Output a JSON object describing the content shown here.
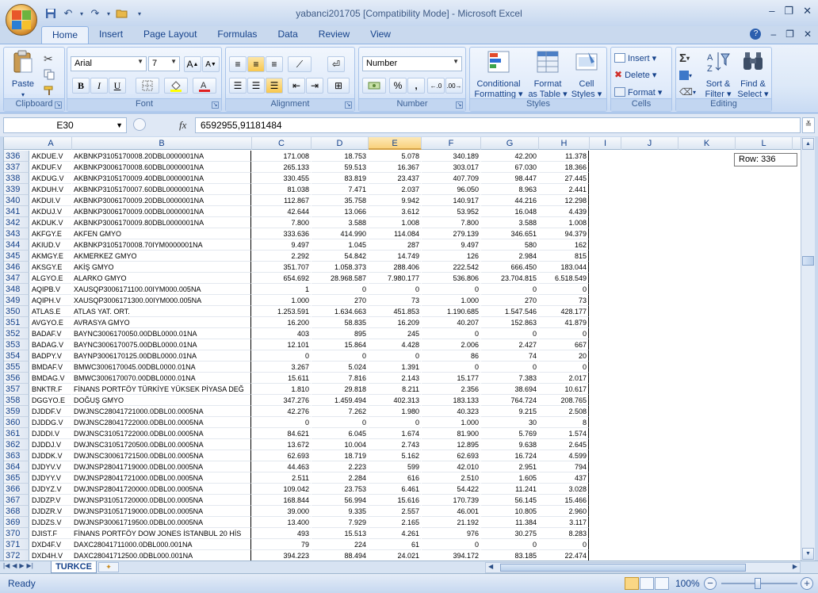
{
  "window": {
    "title": "yabanci201705  [Compatibility Mode] - Microsoft Excel",
    "minimize": "–",
    "restore": "❐",
    "close": "✕"
  },
  "ribbon_tabs": [
    "Home",
    "Insert",
    "Page Layout",
    "Formulas",
    "Data",
    "Review",
    "View"
  ],
  "help_icon": "?",
  "ribbon": {
    "clipboard": {
      "label": "Clipboard",
      "paste": "Paste"
    },
    "font": {
      "label": "Font",
      "font_name": "Arial",
      "font_size": "7"
    },
    "alignment": {
      "label": "Alignment"
    },
    "number": {
      "label": "Number",
      "format": "Number",
      "percent": "%",
      "comma": ",",
      "inc_dec": "⁺⁰.00",
      "dec_dec": ".00→.0"
    },
    "styles": {
      "label": "Styles",
      "conditional": "Conditional",
      "conditional2": "Formatting ▾",
      "format_as": "Format",
      "format_as2": "as Table ▾",
      "cell_styles": "Cell",
      "cell_styles2": "Styles ▾"
    },
    "cells": {
      "label": "Cells",
      "insert": "Insert ▾",
      "delete": "Delete ▾",
      "format": "Format ▾"
    },
    "editing": {
      "label": "Editing",
      "sort": "Sort &",
      "sort2": "Filter ▾",
      "find": "Find &",
      "find2": "Select ▾"
    }
  },
  "formula_bar": {
    "name_box": "E30",
    "fx": "fx",
    "formula": "6592955,91181484"
  },
  "columns": [
    "A",
    "B",
    "C",
    "D",
    "E",
    "F",
    "G",
    "H",
    "I",
    "J",
    "K",
    "L"
  ],
  "selected_column": "E",
  "tooltip": "Row: 336",
  "rows": [
    {
      "n": "336",
      "a": "AKDUE.V",
      "b": "AKBNKP3105170008.20DBL0000001NA",
      "c": "171.008",
      "d": "18.753",
      "e": "5.078",
      "f": "340.189",
      "g": "42.200",
      "h": "11.378"
    },
    {
      "n": "337",
      "a": "AKDUF.V",
      "b": "AKBNKP3006170008.60DBL0000001NA",
      "c": "265.133",
      "d": "59.513",
      "e": "16.367",
      "f": "303.017",
      "g": "67.030",
      "h": "18.366"
    },
    {
      "n": "338",
      "a": "AKDUG.V",
      "b": "AKBNKP3105170009.40DBL0000001NA",
      "c": "330.455",
      "d": "83.819",
      "e": "23.437",
      "f": "407.709",
      "g": "98.447",
      "h": "27.445"
    },
    {
      "n": "339",
      "a": "AKDUH.V",
      "b": "AKBNKP3105170007.60DBL0000001NA",
      "c": "81.038",
      "d": "7.471",
      "e": "2.037",
      "f": "96.050",
      "g": "8.963",
      "h": "2.441"
    },
    {
      "n": "340",
      "a": "AKDUI.V",
      "b": "AKBNKP3006170009.20DBL0000001NA",
      "c": "112.867",
      "d": "35.758",
      "e": "9.942",
      "f": "140.917",
      "g": "44.216",
      "h": "12.298"
    },
    {
      "n": "341",
      "a": "AKDUJ.V",
      "b": "AKBNKP3006170009.00DBL0000001NA",
      "c": "42.644",
      "d": "13.066",
      "e": "3.612",
      "f": "53.952",
      "g": "16.048",
      "h": "4.439"
    },
    {
      "n": "342",
      "a": "AKDUK.V",
      "b": "AKBNKP3006170009.80DBL0000001NA",
      "c": "7.800",
      "d": "3.588",
      "e": "1.008",
      "f": "7.800",
      "g": "3.588",
      "h": "1.008"
    },
    {
      "n": "343",
      "a": "AKFGY.E",
      "b": "AKFEN GMYO",
      "c": "333.636",
      "d": "414.990",
      "e": "114.084",
      "f": "279.139",
      "g": "346.651",
      "h": "94.379"
    },
    {
      "n": "344",
      "a": "AKIUD.V",
      "b": "AKBNKP3105170008.70IYM0000001NA",
      "c": "9.497",
      "d": "1.045",
      "e": "287",
      "f": "9.497",
      "g": "580",
      "h": "162"
    },
    {
      "n": "345",
      "a": "AKMGY.E",
      "b": "AKMERKEZ GMYO",
      "c": "2.292",
      "d": "54.842",
      "e": "14.749",
      "f": "126",
      "g": "2.984",
      "h": "815"
    },
    {
      "n": "346",
      "a": "AKSGY.E",
      "b": "AKİŞ GMYO",
      "c": "351.707",
      "d": "1.058.373",
      "e": "288.406",
      "f": "222.542",
      "g": "666.450",
      "h": "183.044"
    },
    {
      "n": "347",
      "a": "ALGYO.E",
      "b": "ALARKO GMYO",
      "c": "654.692",
      "d": "28.968.587",
      "e": "7.980.177",
      "f": "536.806",
      "g": "23.704.815",
      "h": "6.518.549"
    },
    {
      "n": "348",
      "a": "AQIPB.V",
      "b": "XAUSQP3006171100.00IYM000.005NA",
      "c": "1",
      "d": "0",
      "e": "0",
      "f": "0",
      "g": "0",
      "h": "0"
    },
    {
      "n": "349",
      "a": "AQIPH.V",
      "b": "XAUSQP3006171300.00IYM000.005NA",
      "c": "1.000",
      "d": "270",
      "e": "73",
      "f": "1.000",
      "g": "270",
      "h": "73"
    },
    {
      "n": "350",
      "a": "ATLAS.E",
      "b": "ATLAS YAT. ORT.",
      "c": "1.253.591",
      "d": "1.634.663",
      "e": "451.853",
      "f": "1.190.685",
      "g": "1.547.546",
      "h": "428.177"
    },
    {
      "n": "351",
      "a": "AVGYO.E",
      "b": "AVRASYA GMYO",
      "c": "16.200",
      "d": "58.835",
      "e": "16.209",
      "f": "40.207",
      "g": "152.863",
      "h": "41.879"
    },
    {
      "n": "352",
      "a": "BADAF.V",
      "b": "BAYNC3006170050.00DBL0000.01NA",
      "c": "403",
      "d": "895",
      "e": "245",
      "f": "0",
      "g": "0",
      "h": "0"
    },
    {
      "n": "353",
      "a": "BADAG.V",
      "b": "BAYNC3006170075.00DBL0000.01NA",
      "c": "12.101",
      "d": "15.864",
      "e": "4.428",
      "f": "2.006",
      "g": "2.427",
      "h": "667"
    },
    {
      "n": "354",
      "a": "BADPY.V",
      "b": "BAYNP3006170125.00DBL0000.01NA",
      "c": "0",
      "d": "0",
      "e": "0",
      "f": "86",
      "g": "74",
      "h": "20"
    },
    {
      "n": "355",
      "a": "BMDAF.V",
      "b": "BMWC3006170045.00DBL0000.01NA",
      "c": "3.267",
      "d": "5.024",
      "e": "1.391",
      "f": "0",
      "g": "0",
      "h": "0"
    },
    {
      "n": "356",
      "a": "BMDAG.V",
      "b": "BMWC3006170070.00DBL0000.01NA",
      "c": "15.611",
      "d": "7.816",
      "e": "2.143",
      "f": "15.177",
      "g": "7.383",
      "h": "2.017"
    },
    {
      "n": "357",
      "a": "BNKTR.F",
      "b": "FİNANS PORTFÖY TÜRKİYE YÜKSEK PİYASA DEĞ",
      "c": "1.810",
      "d": "29.818",
      "e": "8.211",
      "f": "2.356",
      "g": "38.694",
      "h": "10.617"
    },
    {
      "n": "358",
      "a": "DGGYO.E",
      "b": "DOĞUŞ GMYO",
      "c": "347.276",
      "d": "1.459.494",
      "e": "402.313",
      "f": "183.133",
      "g": "764.724",
      "h": "208.765"
    },
    {
      "n": "359",
      "a": "DJDDF.V",
      "b": "DWJNSC28041721000.0DBL00.0005NA",
      "c": "42.276",
      "d": "7.262",
      "e": "1.980",
      "f": "40.323",
      "g": "9.215",
      "h": "2.508"
    },
    {
      "n": "360",
      "a": "DJDDG.V",
      "b": "DWJNSC28041722000.0DBL00.0005NA",
      "c": "0",
      "d": "0",
      "e": "0",
      "f": "1.000",
      "g": "30",
      "h": "8"
    },
    {
      "n": "361",
      "a": "DJDDI.V",
      "b": "DWJNSC31051722000.0DBL00.0005NA",
      "c": "84.621",
      "d": "6.045",
      "e": "1.674",
      "f": "81.900",
      "g": "5.769",
      "h": "1.574"
    },
    {
      "n": "362",
      "a": "DJDDJ.V",
      "b": "DWJNSC31051720500.0DBL00.0005NA",
      "c": "13.672",
      "d": "10.004",
      "e": "2.743",
      "f": "12.895",
      "g": "9.638",
      "h": "2.645"
    },
    {
      "n": "363",
      "a": "DJDDK.V",
      "b": "DWJNSC30061721500.0DBL00.0005NA",
      "c": "62.693",
      "d": "18.719",
      "e": "5.162",
      "f": "62.693",
      "g": "16.724",
      "h": "4.599"
    },
    {
      "n": "364",
      "a": "DJDYV.V",
      "b": "DWJNSP28041719000.0DBL00.0005NA",
      "c": "44.463",
      "d": "2.223",
      "e": "599",
      "f": "42.010",
      "g": "2.951",
      "h": "794"
    },
    {
      "n": "365",
      "a": "DJDYY.V",
      "b": "DWJNSP28041721000.0DBL00.0005NA",
      "c": "2.511",
      "d": "2.284",
      "e": "616",
      "f": "2.510",
      "g": "1.605",
      "h": "437"
    },
    {
      "n": "366",
      "a": "DJDYZ.V",
      "b": "DWJNSP28041720000.0DBL00.0005NA",
      "c": "109.042",
      "d": "23.753",
      "e": "6.461",
      "f": "54.422",
      "g": "11.241",
      "h": "3.028"
    },
    {
      "n": "367",
      "a": "DJDZP.V",
      "b": "DWJNSP31051720000.0DBL00.0005NA",
      "c": "168.844",
      "d": "56.994",
      "e": "15.616",
      "f": "170.739",
      "g": "56.145",
      "h": "15.466"
    },
    {
      "n": "368",
      "a": "DJDZR.V",
      "b": "DWJNSP31051719000.0DBL00.0005NA",
      "c": "39.000",
      "d": "9.335",
      "e": "2.557",
      "f": "46.001",
      "g": "10.805",
      "h": "2.960"
    },
    {
      "n": "369",
      "a": "DJDZS.V",
      "b": "DWJNSP30061719500.0DBL00.0005NA",
      "c": "13.400",
      "d": "7.929",
      "e": "2.165",
      "f": "21.192",
      "g": "11.384",
      "h": "3.117"
    },
    {
      "n": "370",
      "a": "DJIST.F",
      "b": "FİNANS PORTFÖY DOW JONES İSTANBUL 20 HİS",
      "c": "493",
      "d": "15.513",
      "e": "4.261",
      "f": "976",
      "g": "30.275",
      "h": "8.283"
    },
    {
      "n": "371",
      "a": "DXD4F.V",
      "b": "DAXC28041711000.0DBL000.001NA",
      "c": "79",
      "d": "224",
      "e": "61",
      "f": "0",
      "g": "0",
      "h": "0"
    },
    {
      "n": "372",
      "a": "DXD4H.V",
      "b": "DAXC28041712500.0DBL000.001NA",
      "c": "394.223",
      "d": "88.494",
      "e": "24.021",
      "f": "394.172",
      "g": "83.185",
      "h": "22.474"
    }
  ],
  "sheet_tab": "TURKCE",
  "status": "Ready",
  "zoom": "100%",
  "zoom_level_percent": 100
}
